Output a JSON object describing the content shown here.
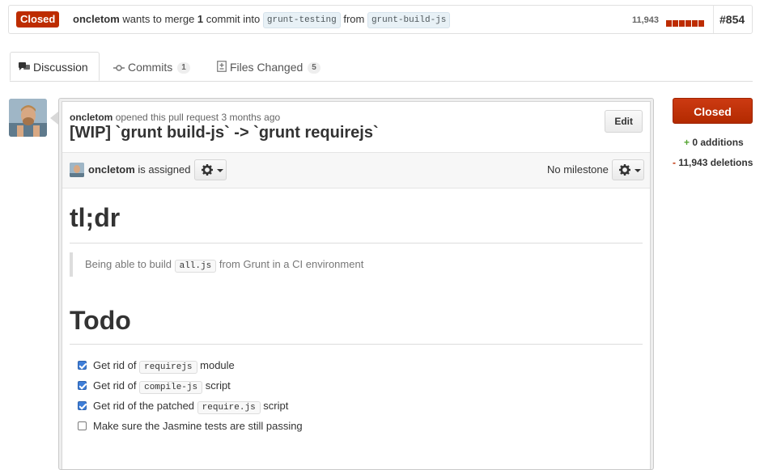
{
  "topbar": {
    "state": "Closed",
    "author": "oncletom",
    "merge_text_1": "wants to merge",
    "commit_count": "1",
    "merge_text_2": "commit into",
    "base_branch": "grunt-testing",
    "from_text": "from",
    "head_branch": "grunt-build-js",
    "diff_count": "11,943",
    "pr_number": "#854",
    "state_color": "#bd2c00"
  },
  "tabs": [
    {
      "label": "Discussion",
      "icon": "discussion-icon",
      "count": ""
    },
    {
      "label": "Commits",
      "icon": "commit-icon",
      "count": "1"
    },
    {
      "label": "Files Changed",
      "icon": "file-diff-icon",
      "count": "5"
    }
  ],
  "discussion": {
    "author": "oncletom",
    "opened_text": "opened this pull request 3 months ago",
    "title": "[WIP] `grunt build-js` -> `grunt requirejs`",
    "edit_label": "Edit",
    "assignee": "oncletom",
    "assigned_text": "is assigned",
    "milestone": "No milestone"
  },
  "body": {
    "heading1": "tl;dr",
    "quote_pre": "Being able to build",
    "quote_code": "all.js",
    "quote_post": "from Grunt in a CI environment",
    "heading2": "Todo",
    "tasks": [
      {
        "checked": true,
        "pre": "Get rid of",
        "code": "requirejs",
        "post": "module"
      },
      {
        "checked": true,
        "pre": "Get rid of",
        "code": "compile-js",
        "post": "script"
      },
      {
        "checked": true,
        "pre": "Get rid of the patched",
        "code": "require.js",
        "post": "script"
      },
      {
        "checked": false,
        "pre": "Make sure the Jasmine tests are still passing",
        "code": "",
        "post": ""
      }
    ]
  },
  "sidebar": {
    "state_button": "Closed",
    "additions_sign": "+",
    "additions": "0 additions",
    "deletions_sign": "-",
    "deletions": "11,943 deletions"
  }
}
